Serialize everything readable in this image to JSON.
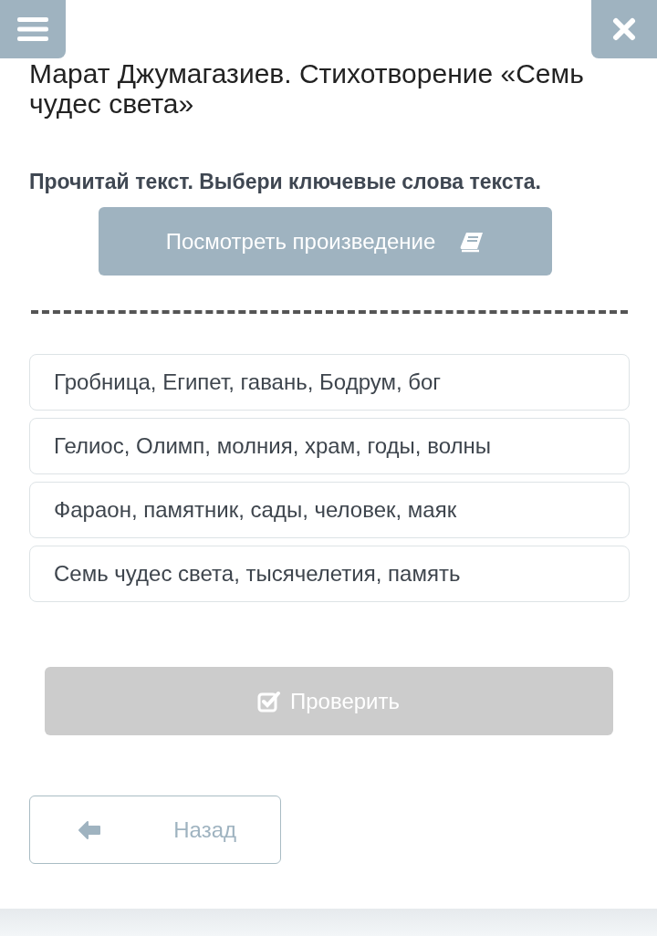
{
  "title": "Марат Джумагазиев. Стихотворение «Семь чудес света»",
  "instruction": "Прочитай текст. Выбери ключевые слова текста.",
  "view_button": {
    "label": "Посмотреть произведение"
  },
  "options": [
    {
      "label": "Гробница, Египет, гавань, Бодрум, бог",
      "selected": false
    },
    {
      "label": "Гелиос, Олимп, молния, храм, годы, волны",
      "selected": false
    },
    {
      "label": "Фараон, памятник, сады, человек, маяк",
      "selected": false
    },
    {
      "label": "Семь чудес света, тысячелетия, память",
      "selected": false
    }
  ],
  "check_button": {
    "label": "Проверить",
    "disabled": true
  },
  "back_button": {
    "label": "Назад"
  }
}
